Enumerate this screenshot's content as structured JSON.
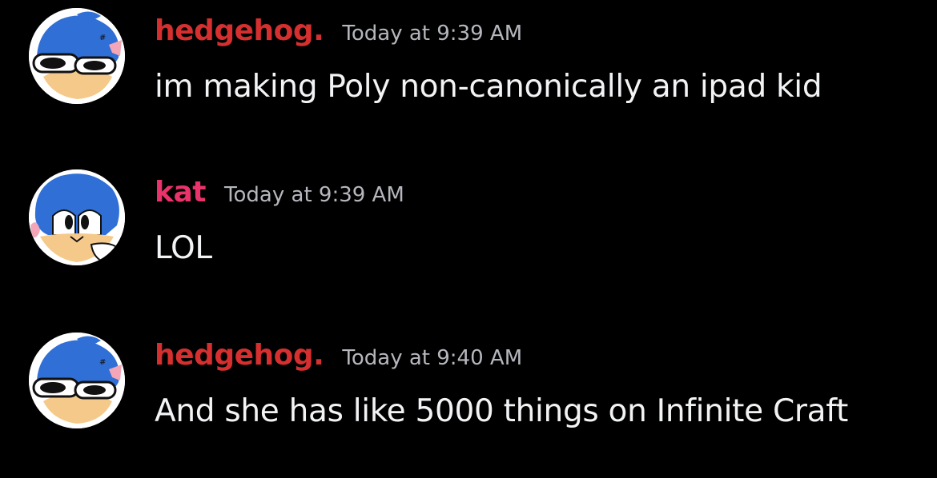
{
  "messages": [
    {
      "username": "hedgehog.",
      "username_color": "#d52f2f",
      "timestamp": "Today at 9:39 AM",
      "text": "im making Poly non-canonically an ipad kid",
      "avatar": "sonic-sunglasses-avatar"
    },
    {
      "username": "kat",
      "username_color": "#e8336b",
      "timestamp": "Today at 9:39 AM",
      "text": "LOL",
      "avatar": "sonic-peace-avatar"
    },
    {
      "username": "hedgehog.",
      "username_color": "#d52f2f",
      "timestamp": "Today at 9:40 AM",
      "text": "And she has like 5000 things on Infinite Craft",
      "avatar": "sonic-sunglasses-avatar"
    }
  ],
  "colors": {
    "background": "#000000",
    "timestamp": "#b5b7bd",
    "message_text": "#f2f3f5",
    "sonic_blue": "#2f6fd6"
  }
}
